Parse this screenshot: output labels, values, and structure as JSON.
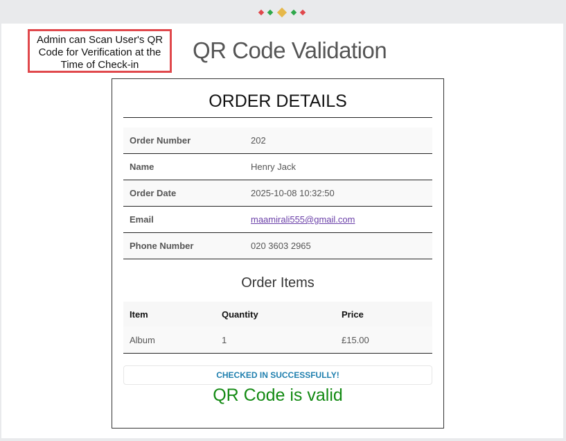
{
  "header": {
    "loader_colors": [
      "#e0484c",
      "#2ea84a",
      "#e6b84a",
      "#2ea84a",
      "#e0484c"
    ]
  },
  "callout": {
    "text": "Admin can Scan User's QR Code for Verification at the Time of Check-in",
    "border_color": "#e0484c"
  },
  "page": {
    "title": "QR Code Validation"
  },
  "order": {
    "heading": "ORDER DETAILS",
    "fields": [
      {
        "label": "Order Number",
        "value": "202"
      },
      {
        "label": "Name",
        "value": "Henry Jack"
      },
      {
        "label": "Order Date",
        "value": "2025-10-08 10:32:50"
      },
      {
        "label": "Email",
        "value": "maamirali555@gmail.com"
      },
      {
        "label": "Phone Number",
        "value": "020 3603 2965"
      }
    ]
  },
  "items": {
    "heading": "Order Items",
    "columns": [
      "Item",
      "Quantity",
      "Price"
    ],
    "rows": [
      [
        "Album",
        "1",
        "£15.00"
      ]
    ]
  },
  "status": {
    "checked_in": "CHECKED IN SUCCESSFULLY!",
    "validity": "QR Code is valid",
    "checked_in_color": "#1f7fae",
    "validity_color": "#138a13"
  }
}
